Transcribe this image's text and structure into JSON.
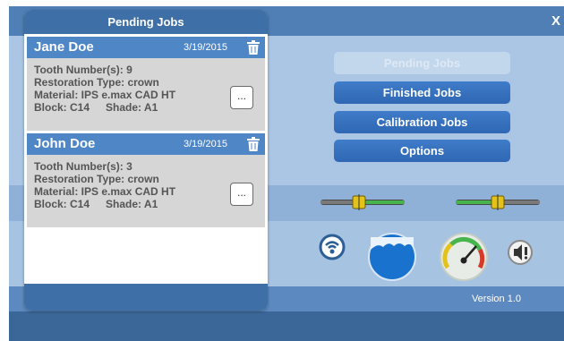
{
  "window": {
    "close_label": "X",
    "version": "Version 1.0"
  },
  "panel": {
    "title": "Pending Jobs",
    "jobs": [
      {
        "name": "Jane Doe",
        "date": "3/19/2015",
        "tooth_numbers": "Tooth Number(s): 9",
        "restoration_type": "Restoration Type: crown",
        "material": "Material: IPS e.max CAD HT",
        "block": "Block: C14",
        "shade": "Shade: A1",
        "more_label": "..."
      },
      {
        "name": "John Doe",
        "date": "3/19/2015",
        "tooth_numbers": "Tooth Number(s): 3",
        "restoration_type": "Restoration Type: crown",
        "material": "Material: IPS e.max CAD HT",
        "block": "Block: C14",
        "shade": "Shade: A1",
        "more_label": "..."
      }
    ]
  },
  "menu": {
    "pending": "Pending Jobs",
    "finished": "Finished Jobs",
    "calibration": "Calibration Jobs",
    "options": "Options"
  },
  "icons": [
    "trash-icon",
    "more-icon",
    "slider-knob-icon",
    "wifi-signal-icon",
    "ocean-wave-icon",
    "gauge-icon",
    "speaker-icon"
  ],
  "colors": {
    "accent": "#2f67b3",
    "header": "#3e6fa7",
    "background": "#aac6e4",
    "card": "#d6d6d6",
    "slider_green": "#48b44c",
    "knob_yellow": "#e3c21a"
  }
}
